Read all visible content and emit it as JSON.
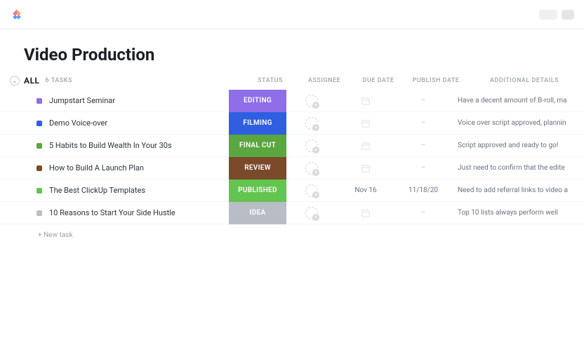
{
  "header": {
    "title": "Video Production"
  },
  "group": {
    "label": "ALL",
    "count_label": "6 TASKS"
  },
  "columns": {
    "status": "STATUS",
    "assignee": "ASSIGNEE",
    "due": "DUE DATE",
    "publish": "PUBLISH DATE",
    "details": "ADDITIONAL DETAILS"
  },
  "tasks": [
    {
      "dot": "#8f6ee9",
      "name": "Jumpstart Seminar",
      "status": "EDITING",
      "status_color": "#8f6ee9",
      "due": "",
      "publish": "–",
      "details": "Have a decent amount of B-roll, ma"
    },
    {
      "dot": "#2f5fe0",
      "name": "Demo Voice-over",
      "status": "FILMING",
      "status_color": "#2f5fe0",
      "due": "",
      "publish": "–",
      "details": "Voice over script approved, plannin"
    },
    {
      "dot": "#5aa63f",
      "name": "5 Habits to Build Wealth In Your 30s",
      "status": "FINAL CUT",
      "status_color": "#5aa63f",
      "due": "",
      "publish": "–",
      "details": "Script approved and ready to go!"
    },
    {
      "dot": "#7a4a2b",
      "name": "How to Build A Launch Plan",
      "status": "REVIEW",
      "status_color": "#7a4a2b",
      "due": "",
      "publish": "–",
      "details": "Just need to confirm that the edite"
    },
    {
      "dot": "#63c44f",
      "name": "The Best ClickUp Templates",
      "status": "PUBLISHED",
      "status_color": "#63c44f",
      "due": "Nov 16",
      "publish": "11/18/20",
      "details": "Need to add referral links to video a"
    },
    {
      "dot": "#b9bec6",
      "name": "10 Reasons to Start Your Side Hustle",
      "status": "IDEA",
      "status_color": "#b9bec6",
      "due": "",
      "publish": "–",
      "details": "Top 10 lists always perform well"
    }
  ],
  "new_task_label": "+ New task"
}
